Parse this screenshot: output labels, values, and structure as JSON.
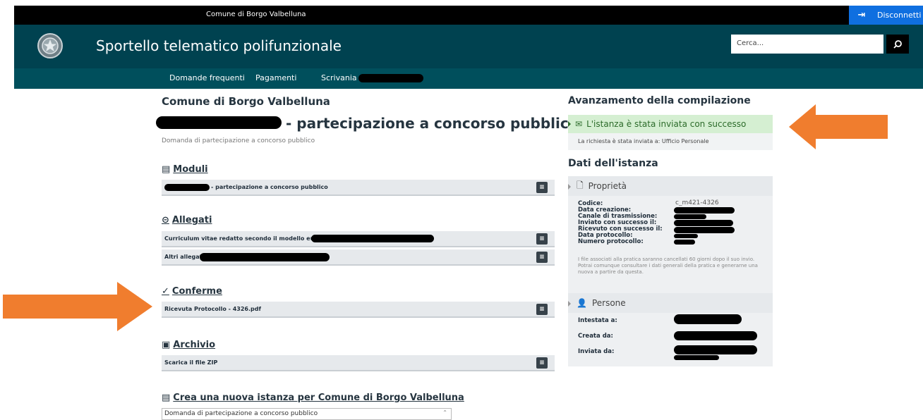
{
  "topbar": {
    "entity_name": "Comune di Borgo Valbelluna",
    "logout_label": "Disconnetti",
    "logout_icon": "logout-icon"
  },
  "header": {
    "title": "Sportello telematico polifunzionale",
    "emblem_icon": "republic-emblem-icon",
    "search_placeholder": "Cerca...",
    "search_icon": "search-icon"
  },
  "nav": {
    "items": [
      "Domande frequenti",
      "Pagamenti",
      "Scrivania di"
    ]
  },
  "main": {
    "entity_title": "Comune di Borgo Valbelluna",
    "page_title": "- partecipazione a concorso pubblico",
    "subtitle": "Domanda di partecipazione a concorso pubblico",
    "sections": {
      "moduli": {
        "title": "Moduli",
        "rows": [
          "- partecipazione a concorso pubblico"
        ]
      },
      "allegati": {
        "title": "Allegati",
        "rows": [
          "Curriculum vitae redatto secondo il modello europeo",
          "Altri allegati"
        ]
      },
      "conferme": {
        "title": "Conferme",
        "rows": [
          "Ricevuta Protocollo - 4326.pdf"
        ]
      },
      "archivio": {
        "title": "Archivio",
        "rows": [
          "Scarica il file ZIP"
        ]
      },
      "nuova": {
        "title": "Crea una nuova istanza per Comune di Borgo Valbelluna",
        "selected": "Domanda di partecipazione a concorso pubblico"
      }
    }
  },
  "side": {
    "progress_title": "Avanzamento della compilazione",
    "success_text": "L'istanza è stata inviata con successo",
    "success_note": "La richiesta è stata inviata a: Ufficio Personale",
    "data_title": "Dati dell'istanza",
    "properties": {
      "title": "Proprietà",
      "labels": [
        "Codice:",
        "Data creazione:",
        "Canale di trasmissione:",
        "Inviato con successo il:",
        "Ricevuto con successo il:",
        "Data protocollo:",
        "Numero protocollo:"
      ],
      "code_value": "c_m421-4326",
      "note": "I file associati alla pratica saranno cancellati 60 giorni dopo il suo invio. Potrai comunque consultare i dati generali della pratica e generarne una nuova a partire da questa."
    },
    "people": {
      "title": "Persone",
      "labels": [
        "Intestata a:",
        "Creata da:",
        "Inviata da:"
      ]
    }
  },
  "colors": {
    "topbar": "#000000",
    "header": "#004250",
    "navbar": "#004f5c",
    "logout": "#0f6fe0",
    "success_bg": "#d5efd2",
    "annotation_arrow": "#f07d2e"
  }
}
